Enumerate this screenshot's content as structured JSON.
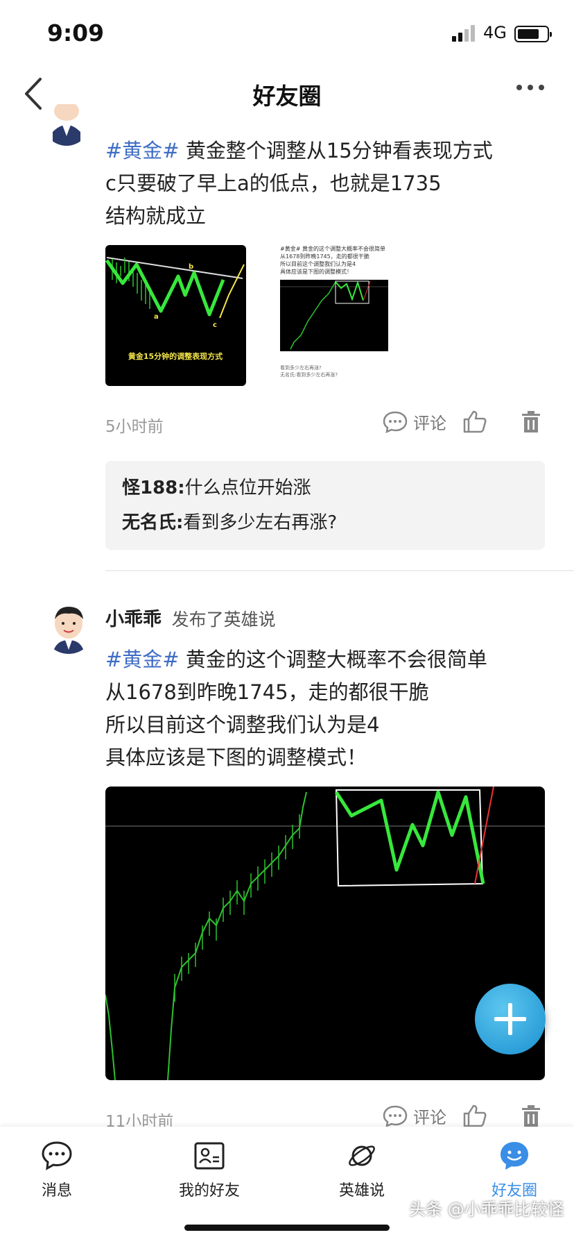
{
  "status_bar": {
    "time": "9:09",
    "network": "4G"
  },
  "header": {
    "title": "好友圈"
  },
  "post1": {
    "hashtag": "#黄金#",
    "lines": [
      "黄金整个调整从15分钟看表现方式",
      "c只要破了早上a的低点，也就是1735",
      "结构就成立"
    ],
    "image1": {
      "labels": [
        "a",
        "b",
        "c"
      ],
      "caption": "黄金15分钟的调整表现方式"
    },
    "image2": {
      "text_lines": [
        "#黄金# 黄金的这个调整大概率不会很简单",
        "从1678到昨晚1745，走的都很干脆",
        "所以目前这个调整我们认为是4",
        "具体应该是下图的调整模式！"
      ],
      "footer_lines": [
        "看到多少左右再涨?",
        "无名氏:看到多少左右再涨?"
      ]
    },
    "time": "5小时前",
    "comment_label": "评论",
    "comments": [
      {
        "user": "怪188:",
        "text": "什么点位开始涨"
      },
      {
        "user": "无名氏:",
        "text": "看到多少左右再涨?"
      }
    ]
  },
  "post2": {
    "username": "小乖乖",
    "action": "发布了英雄说",
    "hashtag": "#黄金#",
    "lines": [
      "黄金的这个调整大概率不会很简单",
      "从1678到昨晚1745，走的都很干脆",
      "所以目前这个调整我们认为是4",
      "具体应该是下图的调整模式！"
    ],
    "time": "11小时前",
    "comment_label": "评论"
  },
  "bottom_nav": [
    {
      "label": "消息",
      "icon": "chat-bubble-icon",
      "active": false
    },
    {
      "label": "我的好友",
      "icon": "contact-card-icon",
      "active": false
    },
    {
      "label": "英雄说",
      "icon": "planet-icon",
      "active": false
    },
    {
      "label": "好友圈",
      "icon": "smile-bubble-icon",
      "active": true
    }
  ],
  "watermark": "头条 @小乖乖比较怪",
  "colors": {
    "accent": "#3f6dc5",
    "active_nav": "#3a8ee6",
    "fab": "#2a9ad8"
  }
}
